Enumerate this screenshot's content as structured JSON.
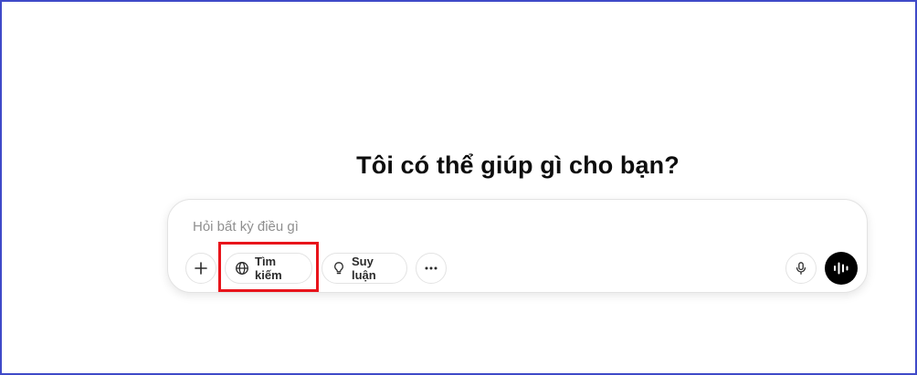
{
  "heading": "Tôi có thể giúp gì cho bạn?",
  "composer": {
    "placeholder": "Hỏi bất kỳ điều gì",
    "value": ""
  },
  "toolbar": {
    "add_icon": "plus-icon",
    "search": {
      "label": "Tìm kiếm",
      "icon": "globe-icon"
    },
    "reason": {
      "label": "Suy luận",
      "icon": "lightbulb-icon"
    },
    "more_icon": "ellipsis-icon",
    "mic_icon": "microphone-icon",
    "voice_icon": "voice-waveform-icon"
  },
  "colors": {
    "frame_border": "#3f4ac8",
    "highlight": "#e8141b",
    "voice_button": "#000000"
  }
}
